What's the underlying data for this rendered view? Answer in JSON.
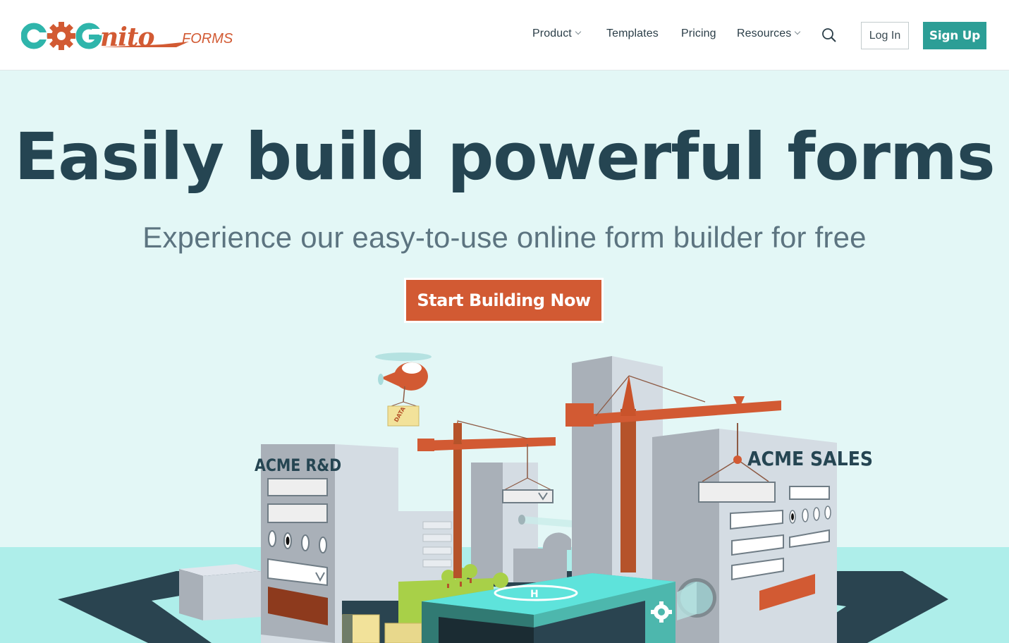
{
  "brand": {
    "logo_main": "COGnito",
    "logo_sub": "FORMS",
    "colors": {
      "teal": "#2fb5ab",
      "orange": "#d25a33",
      "navy": "#254552",
      "hero_bg": "#e3f7f6",
      "signup_bg": "#2c9e96"
    }
  },
  "nav": {
    "items": [
      {
        "label": "Product",
        "has_dropdown": true
      },
      {
        "label": "Templates",
        "has_dropdown": false
      },
      {
        "label": "Pricing",
        "has_dropdown": false
      },
      {
        "label": "Resources",
        "has_dropdown": true
      }
    ],
    "search_icon": "search-icon",
    "login_label": "Log In",
    "signup_label": "Sign Up"
  },
  "hero": {
    "title": "Easily build powerful forms",
    "subtitle": "Experience our easy-to-use online form builder for free",
    "cta_label": "Start Building Now"
  },
  "illustration": {
    "building_left_label": "ACME R&D",
    "building_right_label": "ACME SALES",
    "crate_label": "DATA",
    "helipad_label": "H"
  }
}
